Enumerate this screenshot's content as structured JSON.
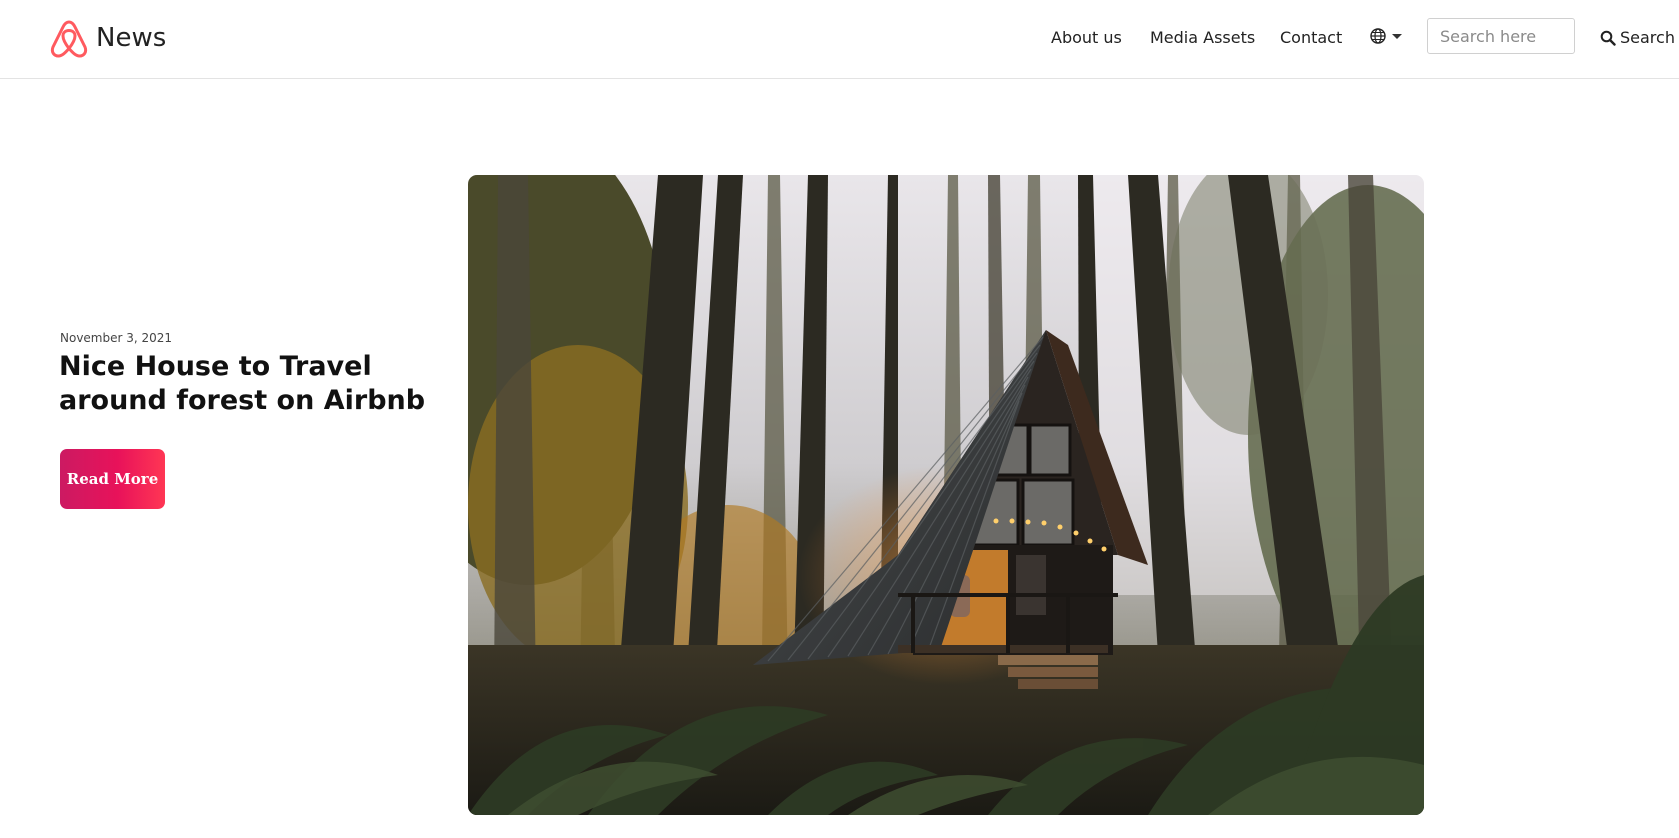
{
  "header": {
    "brand_name": "News",
    "brand_icon": "airbnb-logo-icon",
    "nav": [
      {
        "label": "About us"
      },
      {
        "label": "Media Assets"
      },
      {
        "label": "Contact"
      }
    ],
    "language_icon": "globe-icon",
    "search": {
      "placeholder": "Search here",
      "value": "",
      "button_label": "Search",
      "button_icon": "search-icon"
    }
  },
  "article": {
    "date": "November 3, 2021",
    "title": "Nice House to Travel around forest on Airbnb",
    "read_more_label": "Read More"
  },
  "colors": {
    "brand": "#ff5a5f",
    "button_start": "#cc1a62",
    "button_end": "#ff3654"
  }
}
